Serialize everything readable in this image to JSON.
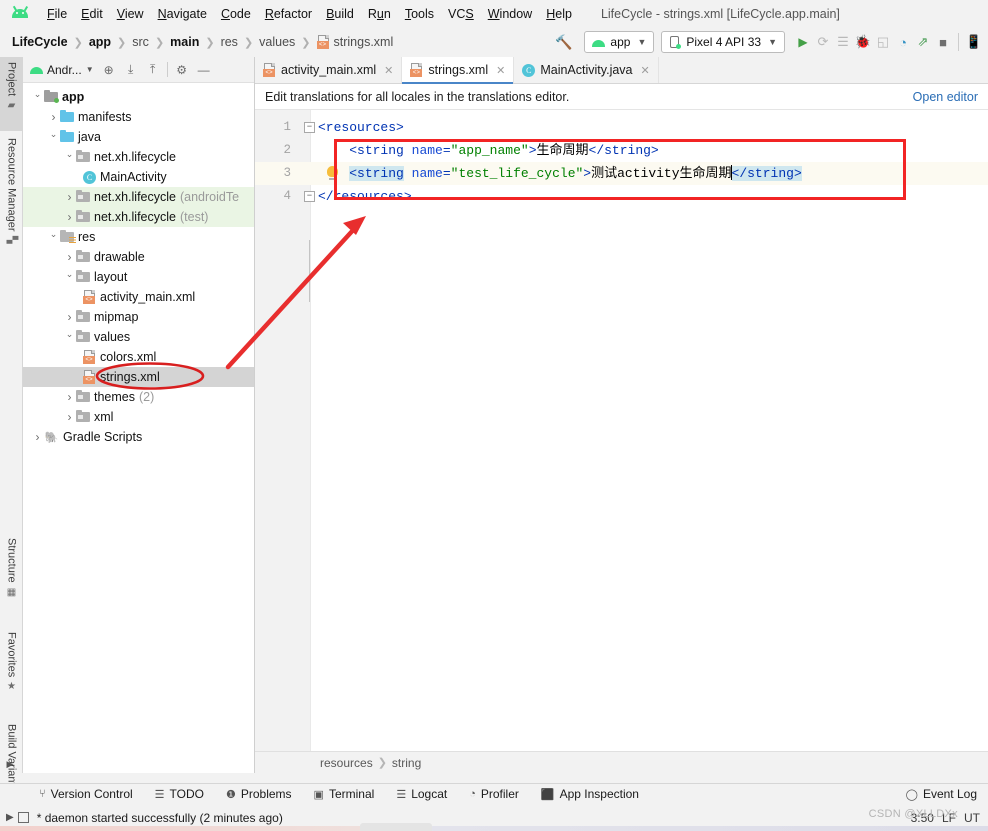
{
  "window": {
    "title": "LifeCycle - strings.xml [LifeCycle.app.main]"
  },
  "menubar": {
    "logo": "android-logo",
    "items": [
      {
        "label": "File"
      },
      {
        "label": "Edit"
      },
      {
        "label": "View"
      },
      {
        "label": "Navigate"
      },
      {
        "label": "Code"
      },
      {
        "label": "Refactor"
      },
      {
        "label": "Build"
      },
      {
        "label": "Run"
      },
      {
        "label": "Tools"
      },
      {
        "label": "VCS"
      },
      {
        "label": "Window"
      },
      {
        "label": "Help"
      }
    ]
  },
  "navbar": {
    "crumbs": [
      {
        "label": "LifeCycle",
        "bold": true
      },
      {
        "label": "app",
        "bold": true
      },
      {
        "label": "src",
        "bold": false
      },
      {
        "label": "main",
        "bold": true
      },
      {
        "label": "res",
        "bold": false
      },
      {
        "label": "values",
        "bold": false
      },
      {
        "label": "strings.xml",
        "bold": false,
        "icon": "xml-file-icon"
      }
    ],
    "build_icon": "hammer-icon",
    "module_selector": "app",
    "device_selector": "Pixel 4 API 33",
    "actions": [
      {
        "name": "run-button",
        "icon": "play-icon"
      },
      {
        "name": "apply-changes-button",
        "icon": "apply-changes-icon"
      },
      {
        "name": "run-with-coverage-button",
        "icon": "coverage-icon"
      },
      {
        "name": "debug-button",
        "icon": "bug-icon"
      },
      {
        "name": "attach-debugger-button",
        "icon": "attach-debugger-icon"
      },
      {
        "name": "profiler-button",
        "icon": "profiler-icon"
      },
      {
        "name": "profile-button",
        "icon": "profile-bug-icon"
      },
      {
        "name": "stop-button",
        "icon": "stop-icon"
      },
      {
        "name": "avd-manager-button",
        "icon": "avd-manager-icon"
      }
    ]
  },
  "left_rail": {
    "items": [
      {
        "label": "Project",
        "icon": "project-folder-icon",
        "active": true
      },
      {
        "label": "Resource Manager",
        "icon": "resource-manager-icon",
        "active": false
      },
      {
        "label": "Structure",
        "icon": "structure-icon",
        "active": false
      },
      {
        "label": "Favorites",
        "icon": "star-icon",
        "active": false
      },
      {
        "label": "Build Variants",
        "icon": "android-variant-icon",
        "active": false
      }
    ]
  },
  "project_panel": {
    "title": "Andr...",
    "header_icons": [
      {
        "name": "locate-file-icon"
      },
      {
        "name": "expand-all-icon"
      },
      {
        "name": "collapse-all-icon"
      },
      {
        "name": "settings-gear-icon"
      },
      {
        "name": "hide-panel-icon"
      }
    ],
    "tree": [
      {
        "label": "app",
        "indent": 0,
        "arrow": "down",
        "icon": "app-module-icon",
        "bold": true
      },
      {
        "label": "manifests",
        "indent": 1,
        "arrow": "right",
        "icon": "folder-icon"
      },
      {
        "label": "java",
        "indent": 1,
        "arrow": "down",
        "icon": "folder-icon"
      },
      {
        "label": "net.xh.lifecycle",
        "indent": 2,
        "arrow": "down",
        "icon": "package-icon"
      },
      {
        "label": "MainActivity",
        "indent": 3,
        "arrow": "none",
        "icon": "java-class-icon"
      },
      {
        "label": "net.xh.lifecycle",
        "suffix": "(androidTe",
        "indent": 2,
        "arrow": "right",
        "icon": "package-icon",
        "highlight": "green"
      },
      {
        "label": "net.xh.lifecycle",
        "suffix": "(test)",
        "indent": 2,
        "arrow": "right",
        "icon": "package-icon",
        "highlight": "green"
      },
      {
        "label": "res",
        "indent": 1,
        "arrow": "down",
        "icon": "res-folder-icon"
      },
      {
        "label": "drawable",
        "indent": 2,
        "arrow": "right",
        "icon": "package-icon"
      },
      {
        "label": "layout",
        "indent": 2,
        "arrow": "down",
        "icon": "package-icon"
      },
      {
        "label": "activity_main.xml",
        "indent": 3,
        "arrow": "none",
        "icon": "xml-file-icon"
      },
      {
        "label": "mipmap",
        "indent": 2,
        "arrow": "right",
        "icon": "package-icon"
      },
      {
        "label": "values",
        "indent": 2,
        "arrow": "down",
        "icon": "package-icon"
      },
      {
        "label": "colors.xml",
        "indent": 3,
        "arrow": "none",
        "icon": "xml-file-icon"
      },
      {
        "label": "strings.xml",
        "indent": 3,
        "arrow": "none",
        "icon": "xml-file-icon",
        "selected": true
      },
      {
        "label": "themes",
        "suffix": "(2)",
        "indent": 2,
        "arrow": "right",
        "icon": "package-icon"
      },
      {
        "label": "xml",
        "indent": 2,
        "arrow": "right",
        "icon": "package-icon"
      },
      {
        "label": "Gradle Scripts",
        "indent": 0,
        "arrow": "right",
        "icon": "gradle-icon"
      }
    ]
  },
  "editor": {
    "tabs": [
      {
        "label": "activity_main.xml",
        "icon": "xml-file-icon",
        "active": false
      },
      {
        "label": "strings.xml",
        "icon": "xml-file-icon",
        "active": true
      },
      {
        "label": "MainActivity.java",
        "icon": "java-class-icon",
        "active": false
      }
    ],
    "notification": {
      "message": "Edit translations for all locales in the translations editor.",
      "link": "Open editor"
    },
    "lines": [
      {
        "number": "1"
      },
      {
        "number": "2"
      },
      {
        "number": "3"
      },
      {
        "number": "4"
      }
    ],
    "code": {
      "line1": "<resources>",
      "line2_open": "<string",
      "line2_attr": "name",
      "line2_value": "\"app_name\"",
      "line2_text": "生命周期",
      "line2_close": "</string>",
      "line3_open": "<string",
      "line3_attr": "name",
      "line3_value": "\"test_life_cycle\"",
      "line3_text": "测试activity生命周期",
      "line3_close": "</string>",
      "line4": "</resources>"
    },
    "breadcrumb": [
      "resources",
      "string"
    ]
  },
  "annotations": {
    "box_color": "#f22424",
    "arrow_color": "#e82e2e",
    "ellipse_color": "#d81f1f"
  },
  "tool_windows": {
    "items": [
      {
        "label": "Version Control",
        "icon": "branch-icon"
      },
      {
        "label": "TODO",
        "icon": "list-icon"
      },
      {
        "label": "Problems",
        "icon": "warning-circle-icon"
      },
      {
        "label": "Terminal",
        "icon": "terminal-icon"
      },
      {
        "label": "Logcat",
        "icon": "logcat-icon"
      },
      {
        "label": "Profiler",
        "icon": "profiler-icon"
      },
      {
        "label": "App Inspection",
        "icon": "inspection-icon"
      }
    ],
    "event_log": {
      "label": "Event Log",
      "icon": "event-log-icon"
    }
  },
  "statusbar": {
    "message": "* daemon started successfully (2 minutes ago)",
    "position": "3:50",
    "line_separator": "LF",
    "encoding": "UT"
  },
  "watermark": "CSDN @XLLDXx"
}
